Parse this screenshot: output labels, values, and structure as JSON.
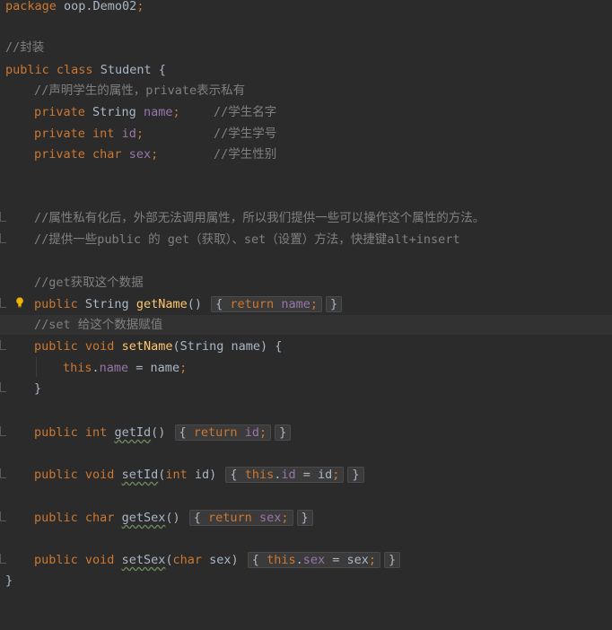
{
  "editor": {
    "lines": {
      "package": {
        "kw": "package",
        "text": " oop.Demo02",
        "semi": ";"
      },
      "comment_fz": "//封装",
      "class_decl": {
        "kw1": "public",
        "kw2": "class",
        "name": " Student {"
      },
      "comment_attrs": "//声明学生的属性，private表示私有",
      "field_name": {
        "kw": "private",
        "type": " String ",
        "name": "name",
        "semi": ";",
        "comment": "//学生名字"
      },
      "field_id": {
        "kw1": "private",
        "kw2": "int",
        "name": "id",
        "semi": ";",
        "comment": "//学生学号"
      },
      "field_sex": {
        "kw1": "private",
        "kw2": "char",
        "name": "sex",
        "semi": ";",
        "comment": "//学生性别"
      },
      "comment_private": "//属性私有化后，外部无法调用属性，所以我们提供一些可以操作这个属性的方法。",
      "comment_getset": "//提供一些public 的 get（获取）、set（设置）方法，快捷键alt+insert",
      "comment_get": "//get获取这个数据",
      "getName": {
        "kw": "public",
        "type": " String ",
        "method": "getName",
        "parens": "()",
        "fold_open": "{",
        "ret": "return",
        "field": "name",
        "semi": ";",
        "fold_close": "}"
      },
      "comment_set": "//set 给这个数据赋值",
      "setName": {
        "kw1": "public",
        "kw2": "void",
        "method": "setName",
        "params": "(String name) {"
      },
      "setName_body": {
        "kw": "this",
        "dot": ".",
        "field": "name",
        "rest": " = name",
        "semi": ";"
      },
      "close_brace_method": "}",
      "getId": {
        "kw1": "public",
        "kw2": "int",
        "method": "getId",
        "parens": "()",
        "fold_open": "{",
        "ret": "return",
        "field": "id",
        "semi": ";",
        "fold_close": "}"
      },
      "setId": {
        "kw1": "public",
        "kw2": "void",
        "method": "setId",
        "p_open": "(",
        "ptype": "int",
        "pname": " id)",
        "fold_open": "{",
        "this": "this",
        "dot": ".",
        "field": "id",
        "rest": " = id",
        "semi": ";",
        "fold_close": "}"
      },
      "getSex": {
        "kw1": "public",
        "kw2": "char",
        "method": "getSex",
        "parens": "()",
        "fold_open": "{",
        "ret": "return",
        "field": "sex",
        "semi": ";",
        "fold_close": "}"
      },
      "setSex": {
        "kw1": "public",
        "kw2": "void",
        "method": "setSex",
        "p_open": "(",
        "ptype": "char",
        "pname": " sex)",
        "fold_open": "{",
        "this": "this",
        "dot": ".",
        "field": "sex",
        "rest": " = sex",
        "semi": ";",
        "fold_close": "}"
      },
      "close_brace_class": "}"
    }
  }
}
